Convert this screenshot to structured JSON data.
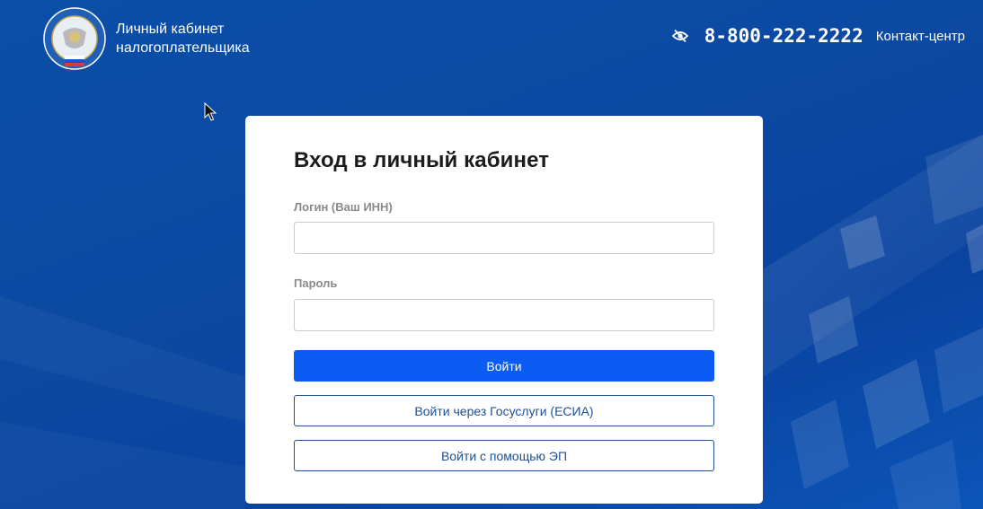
{
  "header": {
    "brand_line1": "Личный кабинет",
    "brand_line2": "налогоплательщика",
    "logo_icon": "fns-emblem-icon",
    "accessibility_icon": "eye-off-icon",
    "phone": "8-800-222-2222",
    "contact_link": "Контакт-центр"
  },
  "login_card": {
    "title": "Вход в личный кабинет",
    "login_label": "Логин (Ваш ИНН)",
    "login_value": "",
    "password_label": "Пароль",
    "password_value": "",
    "submit_label": "Войти",
    "gosuslugi_label": "Войти через Госуслуги (ЕСИА)",
    "ep_label": "Войти с помощью ЭП"
  },
  "colors": {
    "background": "#0b4aa3",
    "primary_button": "#0a5cf5",
    "outline_border": "#1f4f8f",
    "card": "#ffffff"
  }
}
